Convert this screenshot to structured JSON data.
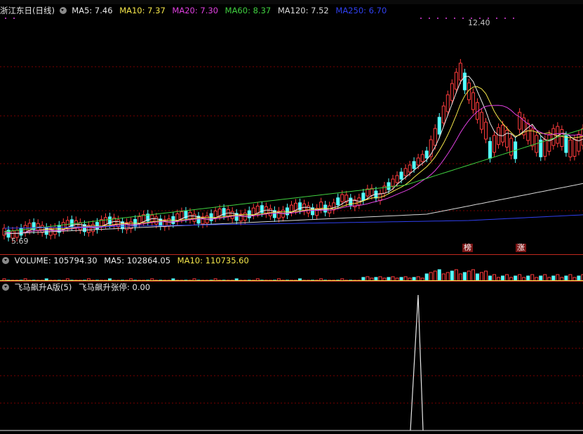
{
  "stock": {
    "name": "浙江东日(日线)"
  },
  "price_legend": [
    {
      "label": "MA5: 7.46",
      "color": "#e8e8e8"
    },
    {
      "label": "MA10: 7.37",
      "color": "#f5e64a"
    },
    {
      "label": "MA20: 7.30",
      "color": "#e040e0"
    },
    {
      "label": "MA60: 8.37",
      "color": "#40d040"
    },
    {
      "label": "MA120: 7.52",
      "color": "#d8d8d8"
    },
    {
      "label": "MA250: 6.70",
      "color": "#3040f0"
    }
  ],
  "volume_legend": [
    {
      "label": "VOLUME: 105794.30",
      "color": "#e8e8e8"
    },
    {
      "label": "MA5: 102864.05",
      "color": "#e8e8e8"
    },
    {
      "label": "MA10: 110735.60",
      "color": "#f5e64a"
    }
  ],
  "indicator_legend": [
    {
      "label": "飞马飙升A版(5)",
      "color": "#e8e8e8"
    },
    {
      "label": "飞马飙升张停: 0.00",
      "color": "#e8e8e8"
    }
  ],
  "price_high_label": "12.40",
  "price_low_label": "5.69",
  "markers": [
    {
      "text": "榜"
    },
    {
      "text": "涨"
    }
  ],
  "colors": {
    "up": "#ff3c3c",
    "down": "#54ffff",
    "separator": "#c0281e",
    "grid": "#7a0000"
  }
}
